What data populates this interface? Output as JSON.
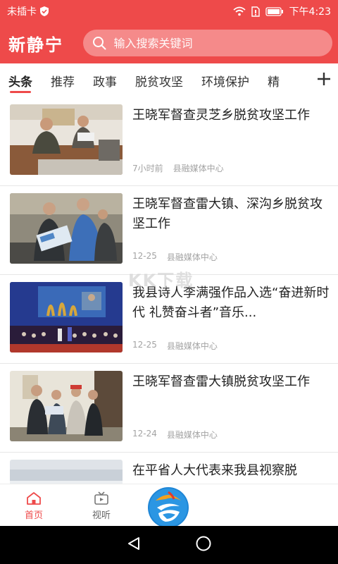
{
  "status_bar": {
    "carrier": "未插卡",
    "time": "下午4:23",
    "icons": [
      "shield-check-icon",
      "wifi-icon",
      "sim-icon",
      "battery-icon"
    ]
  },
  "header": {
    "logo_text": "新静宁",
    "search_placeholder": "输入搜索关键词"
  },
  "tabs": {
    "items": [
      "头条",
      "推荐",
      "政事",
      "脱贫攻坚",
      "环境保护",
      "精"
    ],
    "active_index": 0,
    "more_icon": "plus-icon"
  },
  "news": [
    {
      "title": "王晓军督查灵芝乡脱贫攻坚工作",
      "time": "7小时前",
      "source": "县融媒体中心"
    },
    {
      "title": "王晓军督查雷大镇、深沟乡脱贫攻坚工作",
      "time": "12-25",
      "source": "县融媒体中心"
    },
    {
      "title": "我县诗人李满强作品入选“奋进新时代 礼赞奋斗者”音乐...",
      "time": "12-25",
      "source": "县融媒体中心"
    },
    {
      "title": "王晓军督查雷大镇脱贫攻坚工作",
      "time": "12-24",
      "source": "县融媒体中心"
    },
    {
      "title": "在平省人大代表来我县视察脱",
      "time": "",
      "source": ""
    }
  ],
  "watermark": "KK下载",
  "bottom_nav": {
    "items": [
      {
        "label": "首页",
        "icon": "home-icon"
      },
      {
        "label": "视听",
        "icon": "tv-icon"
      }
    ],
    "center_icon": "app-logo-icon"
  },
  "colors": {
    "brand": "#ee4a4a",
    "text": "#222222",
    "meta": "#a3a3a3"
  }
}
